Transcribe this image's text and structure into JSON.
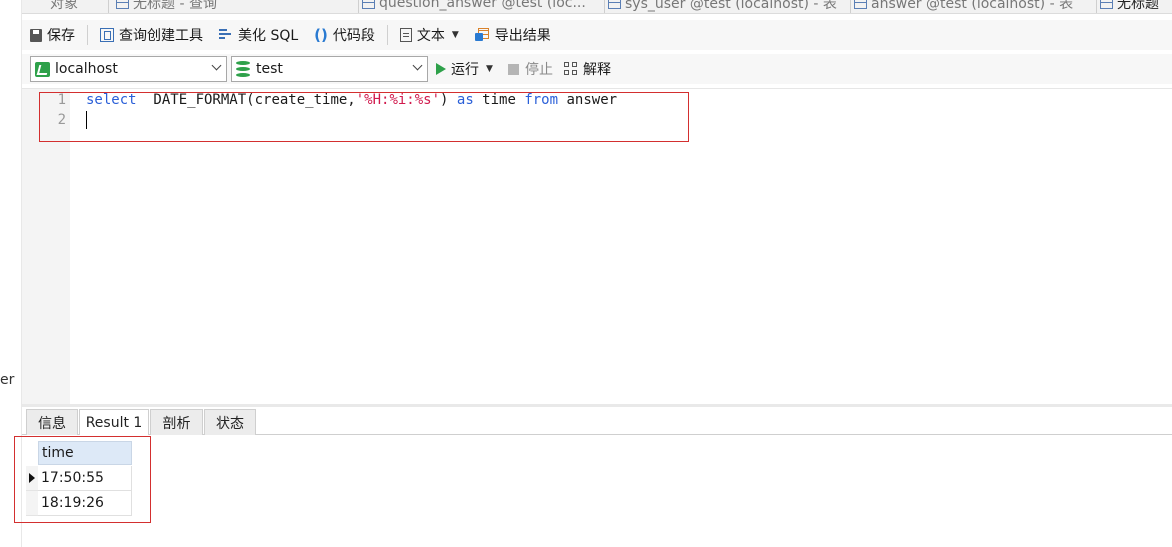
{
  "left_panel": {
    "cut_label": "er"
  },
  "tabs": [
    {
      "label": "对象"
    },
    {
      "label": "无标题 - 查询"
    },
    {
      "label": "question_answer @test (loc..."
    },
    {
      "label": "sys_user @test (localhost) - 表"
    },
    {
      "label": "answer @test (localhost) - 表"
    },
    {
      "label": "无标题"
    }
  ],
  "toolbar": {
    "save": "保存",
    "query_builder": "查询创建工具",
    "beautify_sql": "美化 SQL",
    "code_snippet": "代码段",
    "text": "文本",
    "export": "导出结果"
  },
  "connection": {
    "selected": "localhost"
  },
  "database": {
    "selected": "test"
  },
  "run": {
    "run_label": "运行",
    "stop_label": "停止",
    "explain_label": "解释"
  },
  "editor": {
    "line_numbers": [
      "1",
      "2"
    ],
    "code": {
      "kw_select": "select",
      "func": "  DATE_FORMAT(create_time,",
      "fmt_string": "'%H:%i:%s'",
      "close": ") ",
      "kw_as": "as",
      "alias": " time ",
      "kw_from": "from",
      "table": " answer"
    }
  },
  "result_tabs": [
    "信息",
    "Result 1",
    "剖析",
    "状态"
  ],
  "result_active_tab": "Result 1",
  "result_grid": {
    "columns": [
      "time"
    ],
    "rows": [
      [
        "17:50:55"
      ],
      [
        "18:19:26"
      ]
    ]
  },
  "colors": {
    "annotation": "#d32f2f",
    "keyword": "#2a5fd8",
    "string": "#d11a4d",
    "accent_green": "#2ea14a"
  }
}
